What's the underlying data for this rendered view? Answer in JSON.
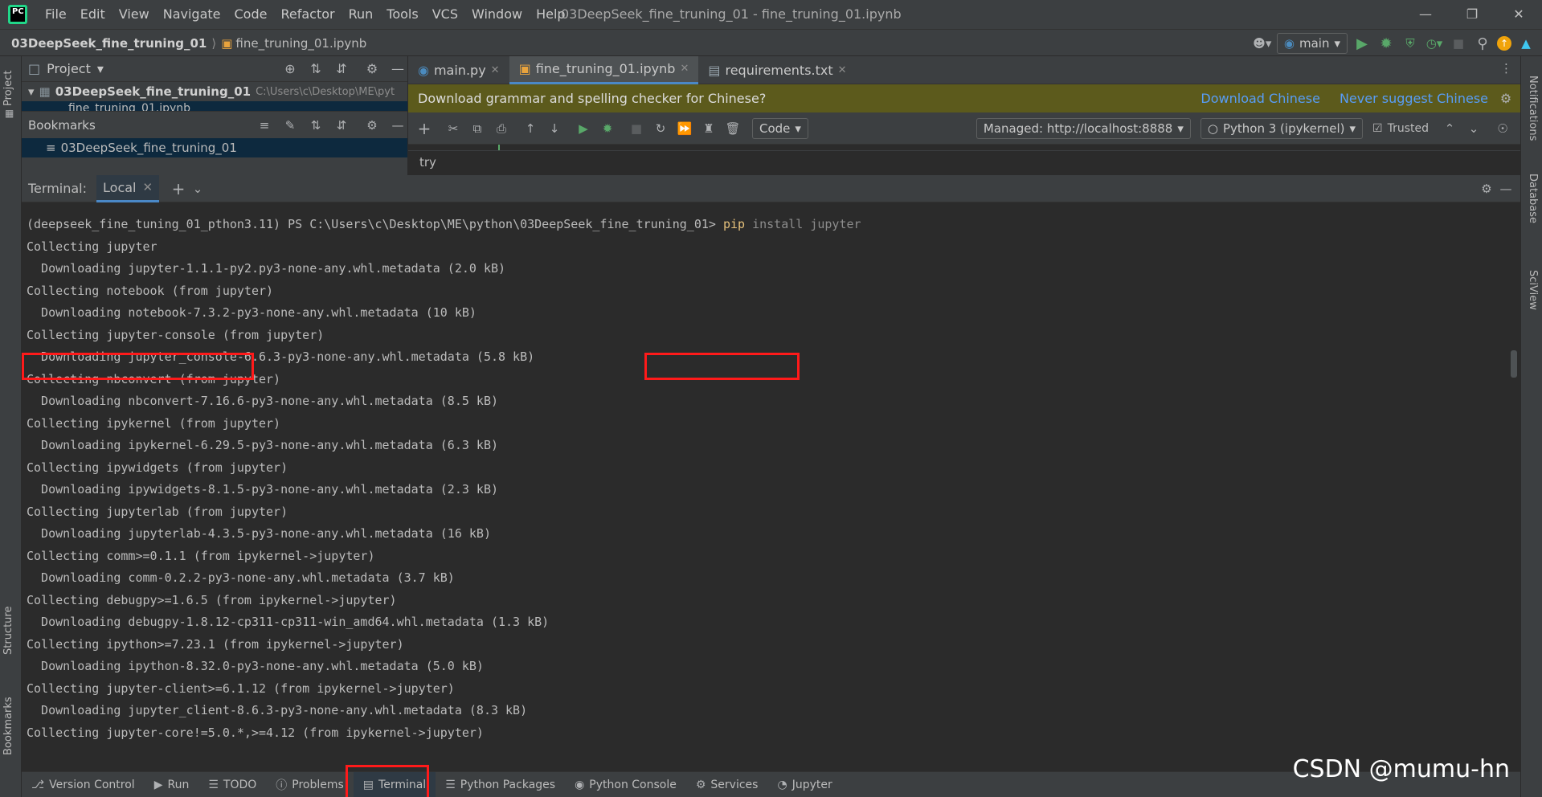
{
  "menubar": {
    "menus": [
      "File",
      "Edit",
      "View",
      "Navigate",
      "Code",
      "Refactor",
      "Run",
      "Tools",
      "VCS",
      "Window",
      "Help"
    ],
    "window_title": "03DeepSeek_fine_truning_01 - fine_truning_01.ipynb"
  },
  "navbar": {
    "project": "03DeepSeek_fine_truning_01",
    "file": "fine_truning_01.ipynb",
    "run_config": "main"
  },
  "project_panel": {
    "title": "Project",
    "root_name": "03DeepSeek_fine_truning_01",
    "root_path": "C:\\Users\\c\\Desktop\\ME\\pyt",
    "child": "fine_truning_01.ipynb",
    "bookmarks_title": "Bookmarks",
    "bookmark_item": "03DeepSeek_fine_truning_01"
  },
  "editor": {
    "tabs": [
      {
        "label": "main.py",
        "icon": "python-file-icon"
      },
      {
        "label": "fine_truning_01.ipynb",
        "icon": "notebook-file-icon"
      },
      {
        "label": "requirements.txt",
        "icon": "text-file-icon"
      }
    ],
    "active_tab": 1,
    "banner_text": "Download grammar and spelling checker for Chinese?",
    "banner_download": "Download Chinese",
    "banner_never": "Never suggest Chinese",
    "cell_type": "Code",
    "server": "Managed: http://localhost:8888",
    "kernel": "Python 3 (ipykernel)",
    "trusted": "Trusted",
    "cell_text": "try"
  },
  "terminal": {
    "label": "Terminal:",
    "tab": "Local",
    "prompt_env": "(deepseek_fine_tuning_01_pthon3.11)",
    "prompt_path": " PS C:\\Users\\c\\Desktop\\ME\\python\\03DeepSeek_fine_truning_01>",
    "command_pip": " pip",
    "command_rest": " install jupyter",
    "lines": [
      "Collecting jupyter",
      "  Downloading jupyter-1.1.1-py2.py3-none-any.whl.metadata (2.0 kB)",
      "Collecting notebook (from jupyter)",
      "  Downloading notebook-7.3.2-py3-none-any.whl.metadata (10 kB)",
      "Collecting jupyter-console (from jupyter)",
      "  Downloading jupyter_console-6.6.3-py3-none-any.whl.metadata (5.8 kB)",
      "Collecting nbconvert (from jupyter)",
      "  Downloading nbconvert-7.16.6-py3-none-any.whl.metadata (8.5 kB)",
      "Collecting ipykernel (from jupyter)",
      "  Downloading ipykernel-6.29.5-py3-none-any.whl.metadata (6.3 kB)",
      "Collecting ipywidgets (from jupyter)",
      "  Downloading ipywidgets-8.1.5-py3-none-any.whl.metadata (2.3 kB)",
      "Collecting jupyterlab (from jupyter)",
      "  Downloading jupyterlab-4.3.5-py3-none-any.whl.metadata (16 kB)",
      "Collecting comm>=0.1.1 (from ipykernel->jupyter)",
      "  Downloading comm-0.2.2-py3-none-any.whl.metadata (3.7 kB)",
      "Collecting debugpy>=1.6.5 (from ipykernel->jupyter)",
      "  Downloading debugpy-1.8.12-cp311-cp311-win_amd64.whl.metadata (1.3 kB)",
      "Collecting ipython>=7.23.1 (from ipykernel->jupyter)",
      "  Downloading ipython-8.32.0-py3-none-any.whl.metadata (5.0 kB)",
      "Collecting jupyter-client>=6.1.12 (from ipykernel->jupyter)",
      "  Downloading jupyter_client-8.6.3-py3-none-any.whl.metadata (8.3 kB)",
      "Collecting jupyter-core!=5.0.*,>=4.12 (from ipykernel->jupyter)"
    ]
  },
  "left_strip": {
    "project": "Project",
    "structure": "Structure",
    "bookmarks": "Bookmarks"
  },
  "right_strip": {
    "notifications": "Notifications",
    "database": "Database",
    "sciview": "SciView"
  },
  "bottom_tools": [
    "Version Control",
    "Run",
    "TODO",
    "Problems",
    "Terminal",
    "Python Packages",
    "Python Console",
    "Services",
    "Jupyter"
  ],
  "watermark": "CSDN @mumu-hn",
  "colors": {
    "accent": "#4a88c7",
    "highlight_box": "#ff1a1a",
    "banner": "#5c5a1c",
    "run_green": "#59a869"
  }
}
